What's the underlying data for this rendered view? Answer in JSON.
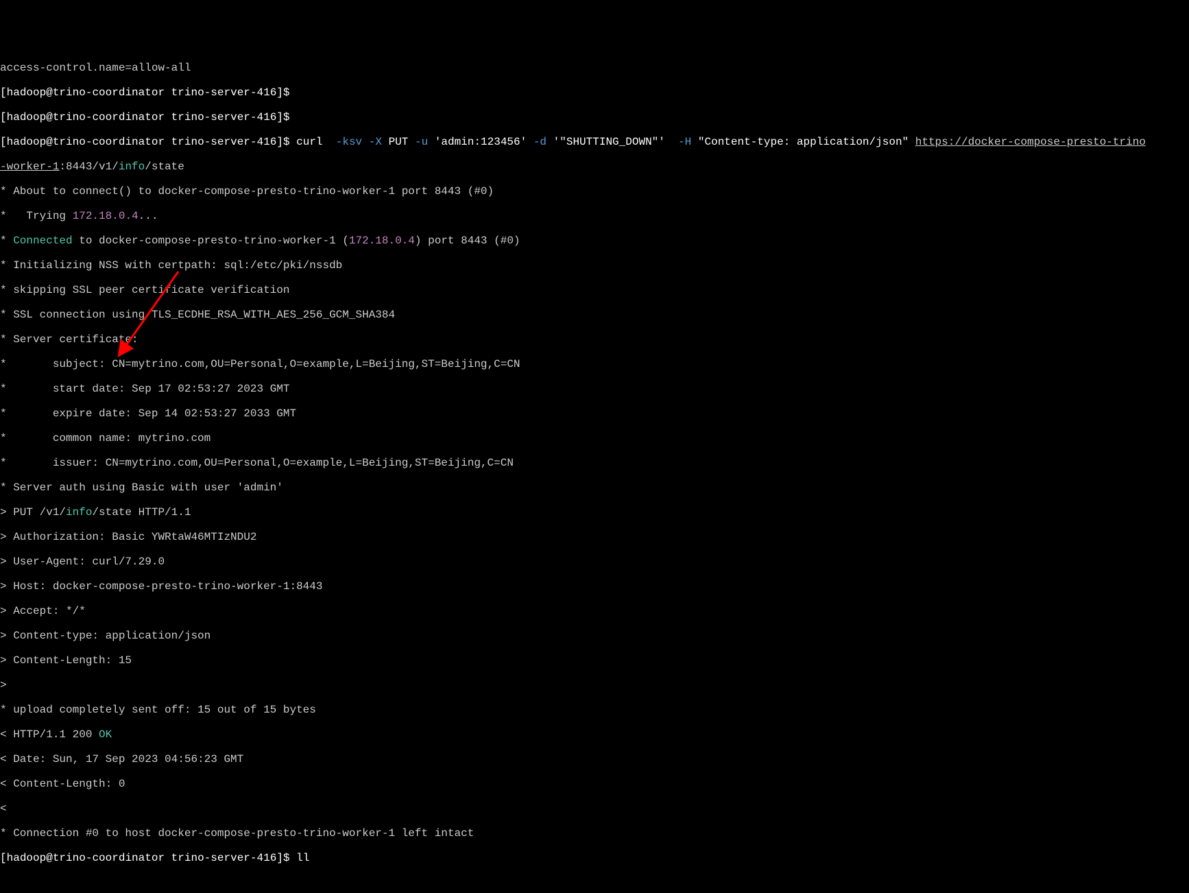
{
  "prompt": {
    "user": "hadoop",
    "host": "trino-coordinator",
    "path": "trino-server-416",
    "dollar": "$"
  },
  "top_cut": "access-control.name=allow-all",
  "cmd": {
    "curl": "curl",
    "flags": "-ksv -X",
    "put": "PUT",
    "u_flag": "-u",
    "creds": "'admin:123456'",
    "d_flag": "-d",
    "body": "'\"SHUTTING_DOWN\"'",
    "h_flag": "-H",
    "header": "\"Content-type: application/json\"",
    "url1": "https://docker-compose-presto-trino",
    "url2_worker": "-worker-1",
    "url2_port": ":8443/v1/",
    "url2_info": "info",
    "url2_state": "/state"
  },
  "out": {
    "l1a": "* About to connect() to docker-compose-presto-trino-worker-1 port 8443 (#0)",
    "l2a": "*   Trying ",
    "l2b": "172.18.0.4",
    "l2c": "...",
    "l3a": "* ",
    "l3b": "Connected",
    "l3c": " to docker-compose-presto-trino-worker-1 (",
    "l3d": "172.18.0.4",
    "l3e": ") port 8443 (#0)",
    "l4": "* Initializing NSS with certpath: sql:/etc/pki/nssdb",
    "l5": "* skipping SSL peer certificate verification",
    "l6": "* SSL connection using TLS_ECDHE_RSA_WITH_AES_256_GCM_SHA384",
    "l7": "* Server certificate:",
    "l8": "*       subject: CN=mytrino.com,OU=Personal,O=example,L=Beijing,ST=Beijing,C=CN",
    "l9": "*       start date: Sep 17 02:53:27 2023 GMT",
    "l10": "*       expire date: Sep 14 02:53:27 2033 GMT",
    "l11": "*       common name: mytrino.com",
    "l12": "*       issuer: CN=mytrino.com,OU=Personal,O=example,L=Beijing,ST=Beijing,C=CN",
    "l13": "* Server auth using Basic with user 'admin'",
    "l14a": "> PUT /v1/",
    "l14b": "info",
    "l14c": "/state HTTP/1.1",
    "l15": "> Authorization: Basic YWRtaW46MTIzNDU2",
    "l16": "> User-Agent: curl/7.29.0",
    "l17": "> Host: docker-compose-presto-trino-worker-1:8443",
    "l18": "> Accept: */*",
    "l19": "> Content-type: application/json",
    "l20": "> Content-Length: 15",
    "l21": "> ",
    "l22": "* upload completely sent off: 15 out of 15 bytes",
    "l23a": "< HTTP/1.1 200 ",
    "l23b": "OK",
    "l24": "< Date: Sun, 17 Sep 2023 04:56:23 GMT",
    "l25": "< Content-Length: 0",
    "l26": "< ",
    "l27": "* Connection #0 to host docker-compose-presto-trino-worker-1 left intact"
  },
  "final_cmd": "ll"
}
